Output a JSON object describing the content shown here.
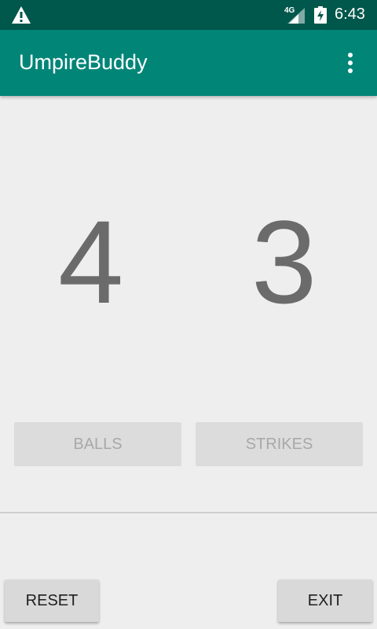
{
  "status_bar": {
    "network_label": "4G",
    "time": "6:43",
    "icons": [
      "warning-icon",
      "signal-icon",
      "battery-charging-icon"
    ]
  },
  "app_bar": {
    "title": "UmpireBuddy",
    "overflow_icon": "more-vert-icon",
    "color": "#008577"
  },
  "counts": {
    "balls": "4",
    "strikes": "3"
  },
  "buttons": {
    "balls": "BALLS",
    "strikes": "STRIKES",
    "reset": "RESET",
    "exit": "EXIT"
  },
  "colors": {
    "status_bar": "#00574b",
    "app_bar": "#008577",
    "background": "#eeeeee"
  }
}
